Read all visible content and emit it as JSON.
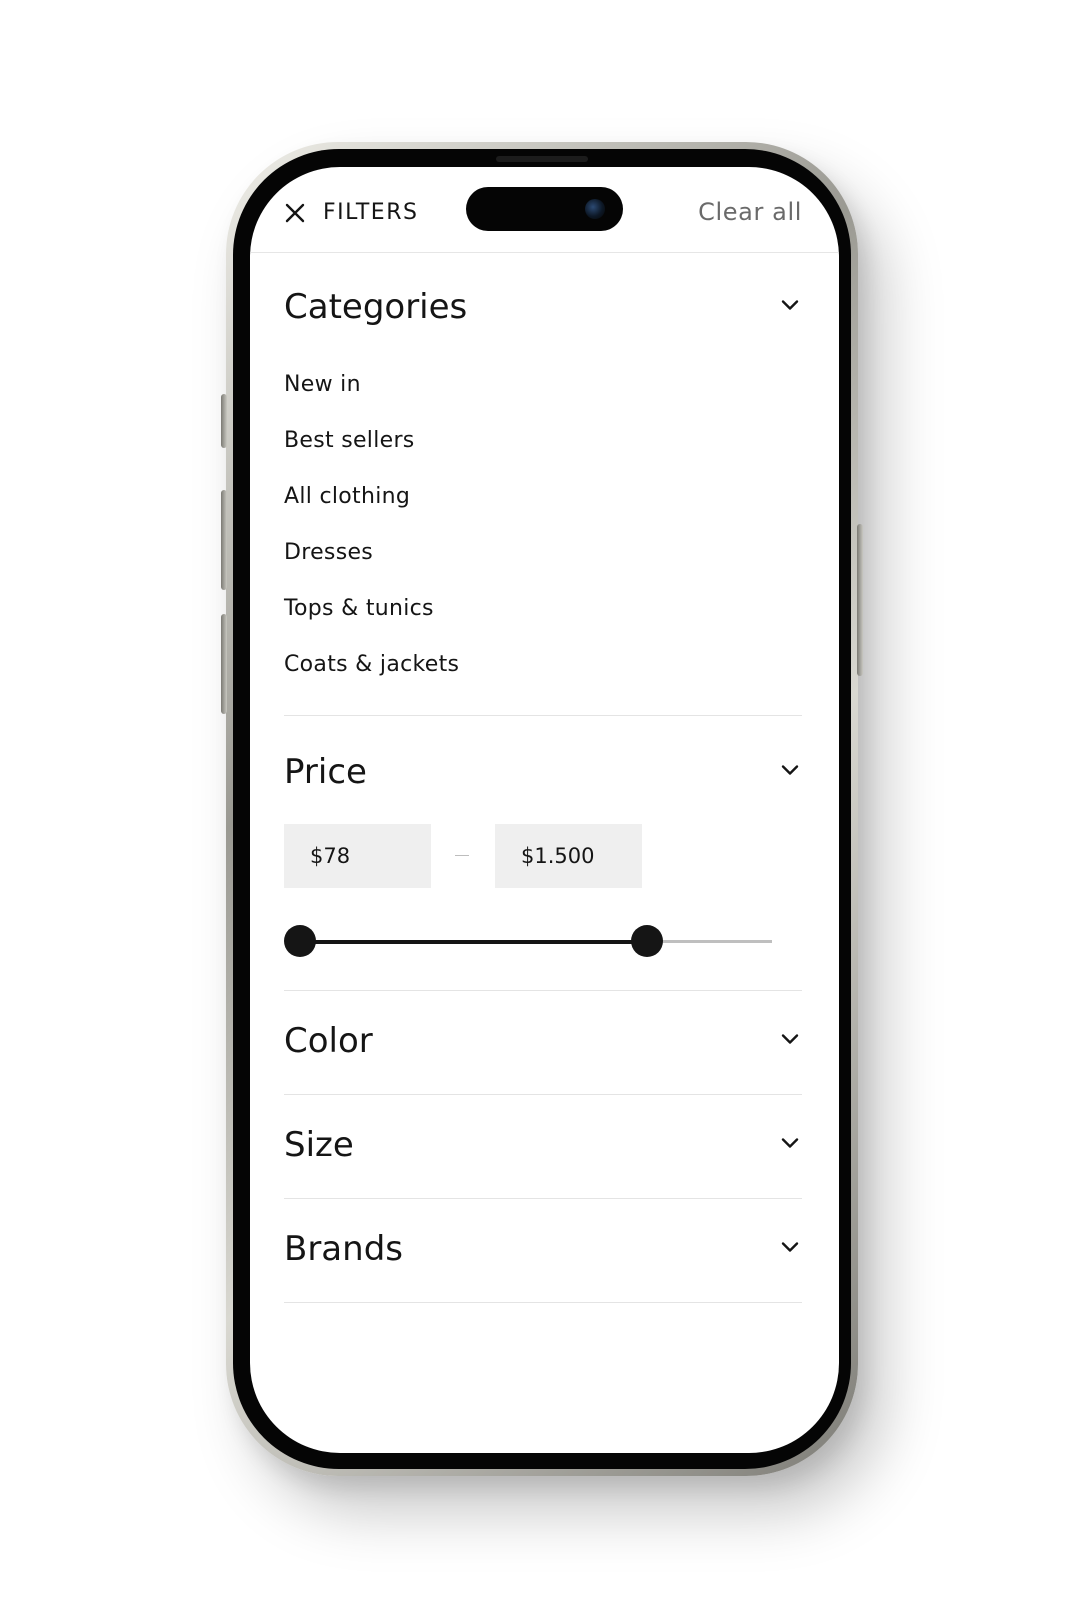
{
  "header": {
    "title": "FILTERS",
    "clear_all": "Clear all"
  },
  "sections": {
    "categories": {
      "title": "Categories",
      "items": [
        "New in",
        "Best sellers",
        "All clothing",
        "Dresses",
        "Tops & tunics",
        "Coats & jackets"
      ]
    },
    "price": {
      "title": "Price",
      "min_value": "$78",
      "max_value": "$1.500",
      "slider_min_fraction": 0.0,
      "slider_max_fraction": 0.76
    },
    "color": {
      "title": "Color"
    },
    "size": {
      "title": "Size"
    },
    "brands": {
      "title": "Brands"
    }
  },
  "icons": {
    "close": "close-icon",
    "chevron": "chevron-down-icon"
  },
  "colors": {
    "text": "#151515",
    "muted": "#6a6a6a",
    "input_bg": "#efefef",
    "divider": "#e4e4e4",
    "slider_inactive": "#bfbfbf"
  }
}
